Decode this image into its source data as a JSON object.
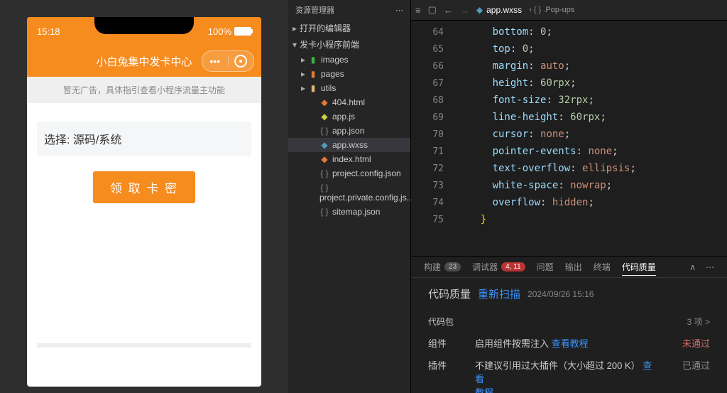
{
  "phone": {
    "time": "15:18",
    "battery": "100%",
    "title": "小白兔集中发卡中心",
    "ad": "暂无广告，具体指引查看小程序流量主功能",
    "select": "选择: 源码/系统",
    "button": "领 取 卡 密"
  },
  "explorer": {
    "title": "资源管理器",
    "sections": {
      "open": "打开的编辑器",
      "project": "发卡小程序前端"
    },
    "folders": [
      "images",
      "pages",
      "utils"
    ],
    "files": [
      "404.html",
      "app.js",
      "app.json",
      "app.wxss",
      "index.html",
      "project.config.json",
      "project.private.config.js...",
      "sitemap.json"
    ]
  },
  "tab": {
    "file": "app.wxss",
    "crumb": ".Pop-ups"
  },
  "code": {
    "start": 64,
    "lines": [
      {
        "p": "bottom",
        "v": "0",
        "u": ""
      },
      {
        "p": "top",
        "v": "0",
        "u": ""
      },
      {
        "p": "margin",
        "v": "auto",
        "u": "",
        "word": true
      },
      {
        "p": "height",
        "v": "60",
        "u": "rpx"
      },
      {
        "p": "font-size",
        "v": "32",
        "u": "rpx"
      },
      {
        "p": "line-height",
        "v": "60",
        "u": "rpx"
      },
      {
        "p": "cursor",
        "v": "none",
        "u": "",
        "word": true
      },
      {
        "p": "pointer-events",
        "v": "none",
        "u": "",
        "word": true
      },
      {
        "p": "text-overflow",
        "v": "ellipsis",
        "u": "",
        "word": true
      },
      {
        "p": "white-space",
        "v": "nowrap",
        "u": "",
        "word": true
      },
      {
        "p": "overflow",
        "v": "hidden",
        "u": "",
        "word": true
      }
    ]
  },
  "bottom": {
    "tabs": {
      "build": "构建",
      "build_badge": "23",
      "debug": "调试器",
      "debug_badge": "4, 11",
      "issues": "问题",
      "output": "输出",
      "terminal": "终端",
      "quality": "代码质量"
    },
    "quality": {
      "title": "代码质量",
      "rescan": "重新扫描",
      "time": "2024/09/26 15:16",
      "pkg": "代码包",
      "pkg_count": "3 项 >",
      "r1_label": "组件",
      "r1_desc": "启用组件按需注入",
      "r1_link": "查看教程",
      "r1_stat": "未通过",
      "r2_label": "插件",
      "r2_desc": "不建议引用过大插件（大小超过 200 K）",
      "r2_link": "查看",
      "r2_link2": "教程",
      "r2_stat": "已通过"
    }
  }
}
